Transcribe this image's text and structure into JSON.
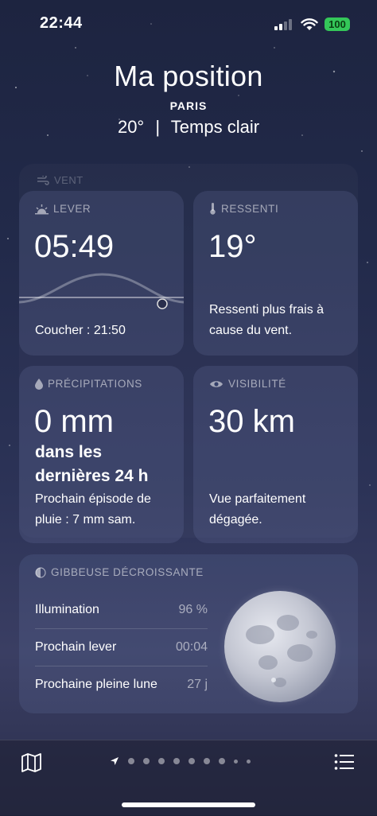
{
  "status_bar": {
    "time": "22:44",
    "battery": "100"
  },
  "header": {
    "title": "Ma position",
    "city": "PARIS",
    "temperature": "20°",
    "separator": "|",
    "condition": "Temps clair"
  },
  "wind": {
    "label": "VENT"
  },
  "sunrise": {
    "label": "LEVER",
    "time": "05:49",
    "sunset": "Coucher : 21:50"
  },
  "feels_like": {
    "label": "RESSENTI",
    "value": "19°",
    "description": "Ressenti plus frais à cause du vent."
  },
  "precipitation": {
    "label": "PRÉCIPITATIONS",
    "value": "0 mm",
    "period": "dans les dernières 24 h",
    "next": "Prochain épisode de pluie : 7 mm sam."
  },
  "visibility": {
    "label": "VISIBILITÉ",
    "value": "30 km",
    "description": "Vue parfaitement dégagée."
  },
  "moon": {
    "label": "GIBBEUSE DÉCROISSANTE",
    "rows": [
      {
        "label": "Illumination",
        "value": "96 %"
      },
      {
        "label": "Prochain lever",
        "value": "00:04"
      },
      {
        "label": "Prochaine pleine lune",
        "value": "27 j"
      }
    ]
  },
  "pager": {
    "count": 10,
    "current": 0
  },
  "icons": [
    "sunrise-icon",
    "thermometer-icon",
    "drop-icon",
    "eye-icon",
    "moon-phase-icon",
    "wind-icon",
    "map-icon",
    "location-arrow-icon",
    "list-icon"
  ]
}
